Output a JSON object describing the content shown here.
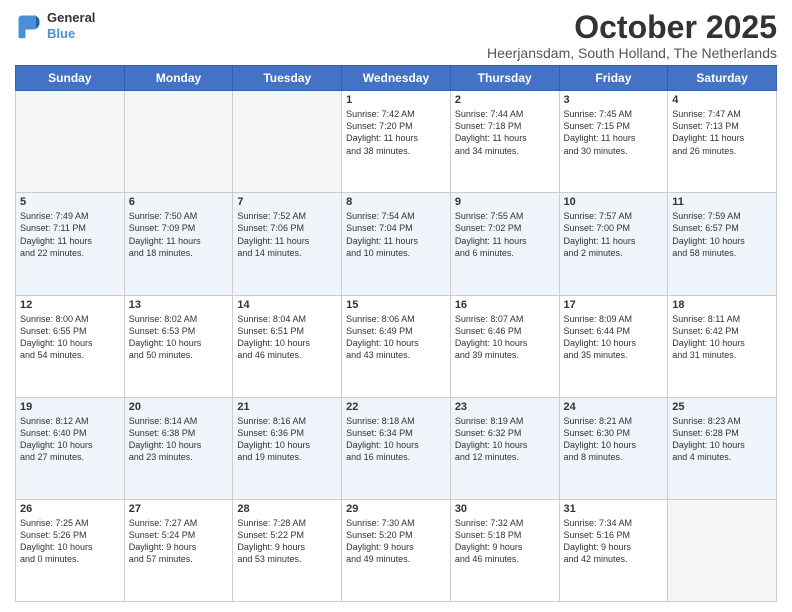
{
  "logo": {
    "line1": "General",
    "line2": "Blue"
  },
  "title": "October 2025",
  "location": "Heerjansdam, South Holland, The Netherlands",
  "days_of_week": [
    "Sunday",
    "Monday",
    "Tuesday",
    "Wednesday",
    "Thursday",
    "Friday",
    "Saturday"
  ],
  "weeks": [
    [
      {
        "num": "",
        "info": ""
      },
      {
        "num": "",
        "info": ""
      },
      {
        "num": "",
        "info": ""
      },
      {
        "num": "1",
        "info": "Sunrise: 7:42 AM\nSunset: 7:20 PM\nDaylight: 11 hours\nand 38 minutes."
      },
      {
        "num": "2",
        "info": "Sunrise: 7:44 AM\nSunset: 7:18 PM\nDaylight: 11 hours\nand 34 minutes."
      },
      {
        "num": "3",
        "info": "Sunrise: 7:45 AM\nSunset: 7:15 PM\nDaylight: 11 hours\nand 30 minutes."
      },
      {
        "num": "4",
        "info": "Sunrise: 7:47 AM\nSunset: 7:13 PM\nDaylight: 11 hours\nand 26 minutes."
      }
    ],
    [
      {
        "num": "5",
        "info": "Sunrise: 7:49 AM\nSunset: 7:11 PM\nDaylight: 11 hours\nand 22 minutes."
      },
      {
        "num": "6",
        "info": "Sunrise: 7:50 AM\nSunset: 7:09 PM\nDaylight: 11 hours\nand 18 minutes."
      },
      {
        "num": "7",
        "info": "Sunrise: 7:52 AM\nSunset: 7:06 PM\nDaylight: 11 hours\nand 14 minutes."
      },
      {
        "num": "8",
        "info": "Sunrise: 7:54 AM\nSunset: 7:04 PM\nDaylight: 11 hours\nand 10 minutes."
      },
      {
        "num": "9",
        "info": "Sunrise: 7:55 AM\nSunset: 7:02 PM\nDaylight: 11 hours\nand 6 minutes."
      },
      {
        "num": "10",
        "info": "Sunrise: 7:57 AM\nSunset: 7:00 PM\nDaylight: 11 hours\nand 2 minutes."
      },
      {
        "num": "11",
        "info": "Sunrise: 7:59 AM\nSunset: 6:57 PM\nDaylight: 10 hours\nand 58 minutes."
      }
    ],
    [
      {
        "num": "12",
        "info": "Sunrise: 8:00 AM\nSunset: 6:55 PM\nDaylight: 10 hours\nand 54 minutes."
      },
      {
        "num": "13",
        "info": "Sunrise: 8:02 AM\nSunset: 6:53 PM\nDaylight: 10 hours\nand 50 minutes."
      },
      {
        "num": "14",
        "info": "Sunrise: 8:04 AM\nSunset: 6:51 PM\nDaylight: 10 hours\nand 46 minutes."
      },
      {
        "num": "15",
        "info": "Sunrise: 8:06 AM\nSunset: 6:49 PM\nDaylight: 10 hours\nand 43 minutes."
      },
      {
        "num": "16",
        "info": "Sunrise: 8:07 AM\nSunset: 6:46 PM\nDaylight: 10 hours\nand 39 minutes."
      },
      {
        "num": "17",
        "info": "Sunrise: 8:09 AM\nSunset: 6:44 PM\nDaylight: 10 hours\nand 35 minutes."
      },
      {
        "num": "18",
        "info": "Sunrise: 8:11 AM\nSunset: 6:42 PM\nDaylight: 10 hours\nand 31 minutes."
      }
    ],
    [
      {
        "num": "19",
        "info": "Sunrise: 8:12 AM\nSunset: 6:40 PM\nDaylight: 10 hours\nand 27 minutes."
      },
      {
        "num": "20",
        "info": "Sunrise: 8:14 AM\nSunset: 6:38 PM\nDaylight: 10 hours\nand 23 minutes."
      },
      {
        "num": "21",
        "info": "Sunrise: 8:16 AM\nSunset: 6:36 PM\nDaylight: 10 hours\nand 19 minutes."
      },
      {
        "num": "22",
        "info": "Sunrise: 8:18 AM\nSunset: 6:34 PM\nDaylight: 10 hours\nand 16 minutes."
      },
      {
        "num": "23",
        "info": "Sunrise: 8:19 AM\nSunset: 6:32 PM\nDaylight: 10 hours\nand 12 minutes."
      },
      {
        "num": "24",
        "info": "Sunrise: 8:21 AM\nSunset: 6:30 PM\nDaylight: 10 hours\nand 8 minutes."
      },
      {
        "num": "25",
        "info": "Sunrise: 8:23 AM\nSunset: 6:28 PM\nDaylight: 10 hours\nand 4 minutes."
      }
    ],
    [
      {
        "num": "26",
        "info": "Sunrise: 7:25 AM\nSunset: 5:26 PM\nDaylight: 10 hours\nand 0 minutes."
      },
      {
        "num": "27",
        "info": "Sunrise: 7:27 AM\nSunset: 5:24 PM\nDaylight: 9 hours\nand 57 minutes."
      },
      {
        "num": "28",
        "info": "Sunrise: 7:28 AM\nSunset: 5:22 PM\nDaylight: 9 hours\nand 53 minutes."
      },
      {
        "num": "29",
        "info": "Sunrise: 7:30 AM\nSunset: 5:20 PM\nDaylight: 9 hours\nand 49 minutes."
      },
      {
        "num": "30",
        "info": "Sunrise: 7:32 AM\nSunset: 5:18 PM\nDaylight: 9 hours\nand 46 minutes."
      },
      {
        "num": "31",
        "info": "Sunrise: 7:34 AM\nSunset: 5:16 PM\nDaylight: 9 hours\nand 42 minutes."
      },
      {
        "num": "",
        "info": ""
      }
    ]
  ]
}
